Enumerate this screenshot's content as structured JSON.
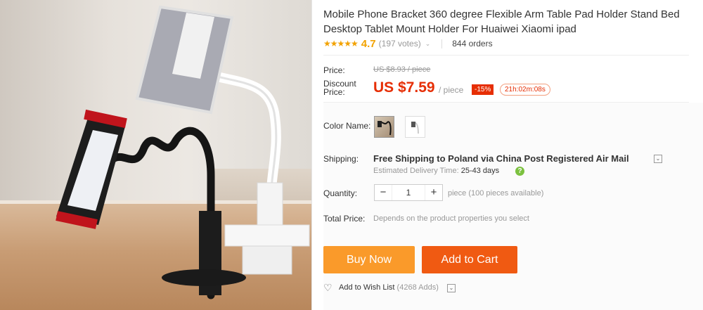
{
  "product": {
    "title": "Mobile Phone Bracket 360 degree Flexible Arm Table Pad Holder Stand Bed Desktop Tablet Mount Holder For Huaiwei Xiaomi ipad",
    "rating": "4.7",
    "votes": "(197 votes)",
    "orders": "844 orders"
  },
  "pricing": {
    "price_label": "Price:",
    "old_price": "US $8.93 / piece",
    "discount_label": "Discount Price:",
    "new_price": "US $7.59",
    "per_piece": "/ piece",
    "discount_pct": "-15%",
    "timer": "21h:02m:08s"
  },
  "color": {
    "label": "Color Name:"
  },
  "shipping": {
    "label": "Shipping:",
    "text": "Free Shipping to Poland via China Post Registered Air Mail",
    "eta_label": "Estimated Delivery Time:",
    "eta_days": "25-43 days",
    "info_icon": "?"
  },
  "quantity": {
    "label": "Quantity:",
    "minus": "−",
    "value": "1",
    "plus": "+",
    "available": "piece (100 pieces available)"
  },
  "total": {
    "label": "Total Price:",
    "text": "Depends on the product properties you select"
  },
  "actions": {
    "buy_now": "Buy Now",
    "add_to_cart": "Add to Cart",
    "wish": "Add to Wish List",
    "wish_adds": "(4268 Adds)"
  },
  "icons": {
    "stars": "★★★★★",
    "heart": "♡",
    "caret": "⌄"
  },
  "colors": {
    "price_red": "#e62e04",
    "buy_orange": "#fa9a2a",
    "cart_orange": "#f05a12",
    "star_gold": "#f2a200",
    "eta_green": "#7cc140"
  }
}
